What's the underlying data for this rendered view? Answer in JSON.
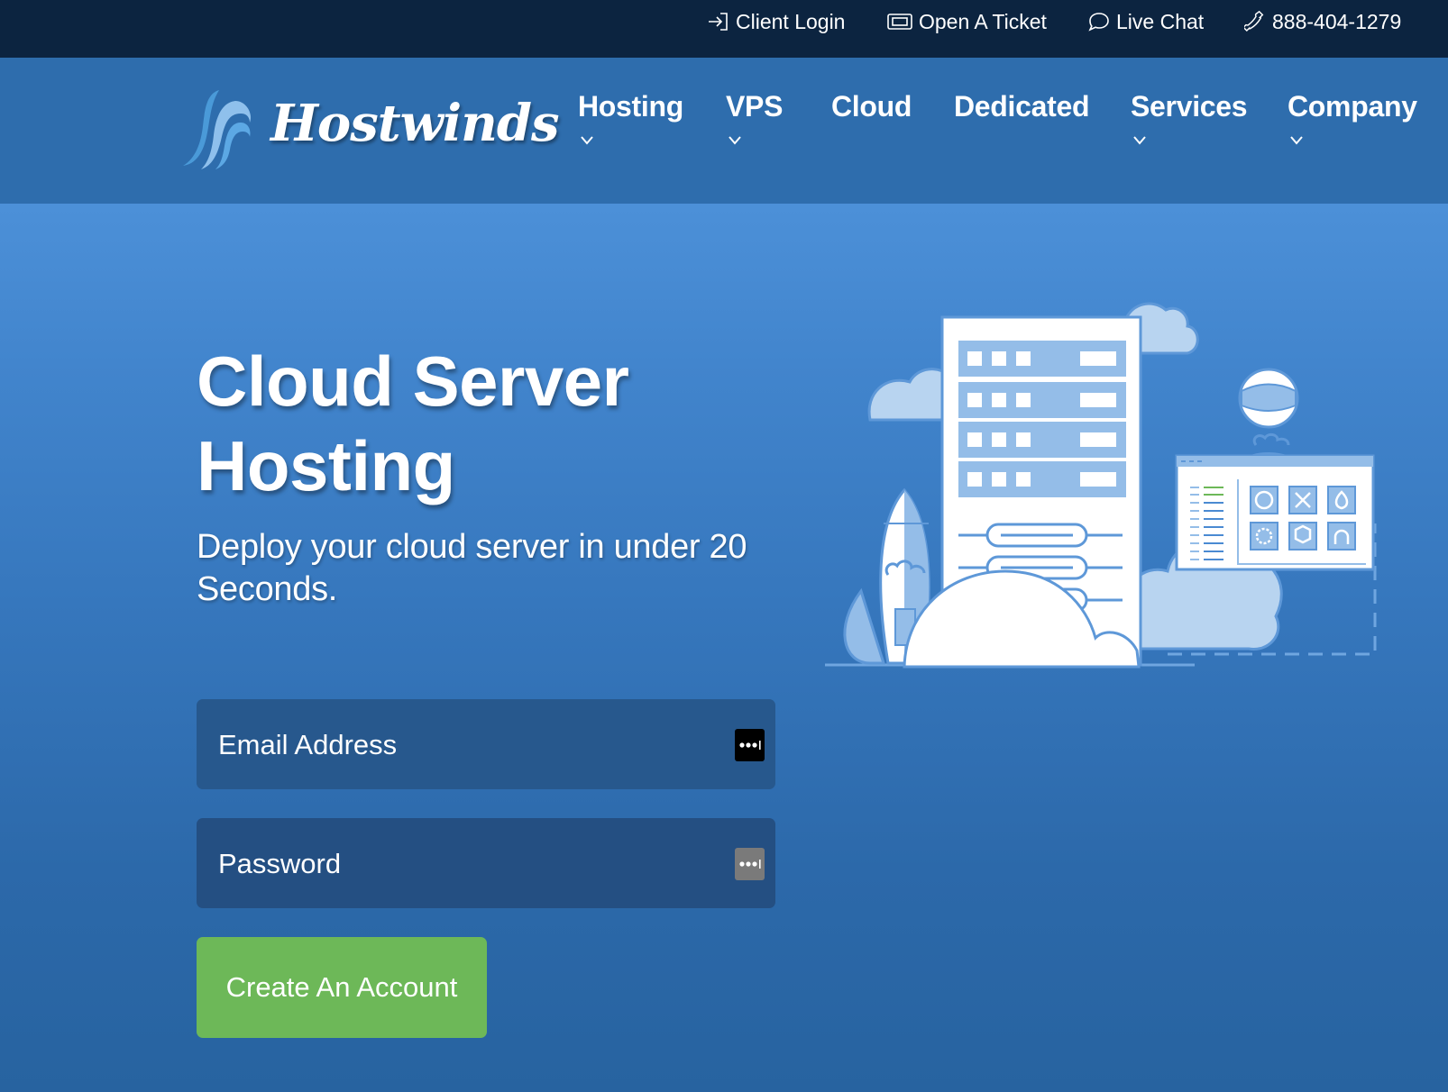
{
  "topbar": {
    "links": [
      {
        "label": "Client Login",
        "icon": "login-arrow-icon"
      },
      {
        "label": "Open A Ticket",
        "icon": "ticket-icon"
      },
      {
        "label": "Live Chat",
        "icon": "chat-bubble-icon"
      },
      {
        "label": "888-404-1279",
        "icon": "phone-icon"
      }
    ]
  },
  "brand": {
    "name": "Hostwinds",
    "logo_icon": "wind-waves-logo-icon"
  },
  "nav": {
    "items": [
      {
        "label": "Hosting",
        "has_dropdown": true
      },
      {
        "label": "VPS",
        "has_dropdown": true
      },
      {
        "label": "Cloud",
        "has_dropdown": false
      },
      {
        "label": "Dedicated",
        "has_dropdown": false
      },
      {
        "label": "Services",
        "has_dropdown": true
      },
      {
        "label": "Company",
        "has_dropdown": true
      }
    ]
  },
  "hero": {
    "title": "Cloud Server Hosting",
    "subtitle": "Deploy your cloud server in under 20 Seconds.",
    "form": {
      "email": {
        "value": "",
        "placeholder": "Email Address"
      },
      "password": {
        "value": "",
        "placeholder": "Password"
      },
      "submit_label": "Create An Account"
    },
    "illustration": {
      "description": "server rack with clouds, rocket, astronaut and control panel",
      "app_icons": [
        "wordpress-icon",
        "joomla-icon",
        "drupal-icon",
        "spinner-app-icon",
        "cube-app-icon",
        "openvpn-icon"
      ]
    }
  },
  "colors": {
    "topbar_bg": "#0c2440",
    "nav_bg": "#2e6dad",
    "hero_top": "#4c90d8",
    "hero_bottom": "#2763a0",
    "field_bg": "#27588d",
    "cta_green": "#6db858",
    "illustration_light": "#b8d4f0"
  }
}
